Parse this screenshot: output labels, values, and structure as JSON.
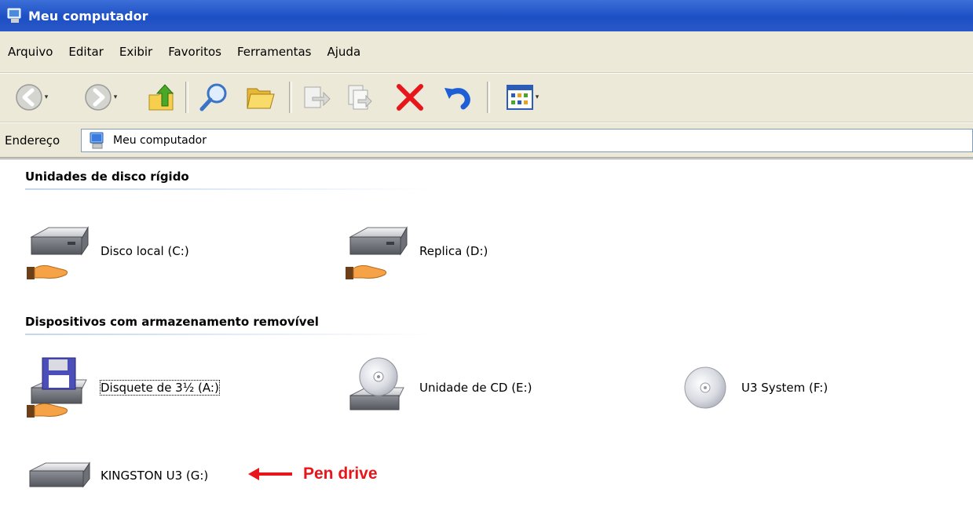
{
  "window": {
    "title": "Meu computador",
    "title_icon": "my-computer-icon"
  },
  "menu": {
    "items": [
      "Arquivo",
      "Editar",
      "Exibir",
      "Favoritos",
      "Ferramentas",
      "Ajuda"
    ]
  },
  "toolbar": {
    "buttons": [
      "back-icon",
      "forward-icon",
      "up-folder-icon",
      "search-icon",
      "folders-icon",
      "move-to-icon",
      "copy-to-icon",
      "delete-icon",
      "undo-icon",
      "views-icon"
    ],
    "colors": {
      "delete": "#e8161b",
      "undo": "#1f5fd6"
    }
  },
  "address": {
    "label": "Endereço",
    "value": "Meu computador"
  },
  "groups": {
    "hard_drives": {
      "header": "Unidades de disco rígido",
      "items": [
        {
          "label": "Disco local (C:)",
          "icon": "shared-hard-drive-icon"
        },
        {
          "label": "Replica (D:)",
          "icon": "shared-hard-drive-icon"
        }
      ]
    },
    "removable": {
      "header": "Dispositivos com armazenamento removível",
      "items": [
        {
          "label": "Disquete de 3½ (A:)",
          "icon": "shared-floppy-drive-icon"
        },
        {
          "label": "Unidade de CD (E:)",
          "icon": "cd-drive-icon"
        },
        {
          "label": "U3 System (F:)",
          "icon": "cd-disc-icon"
        },
        {
          "label": "KINGSTON U3 (G:)",
          "icon": "removable-drive-icon"
        }
      ]
    }
  },
  "annotation": {
    "text": "Pen drive",
    "color": "#e8161b"
  }
}
